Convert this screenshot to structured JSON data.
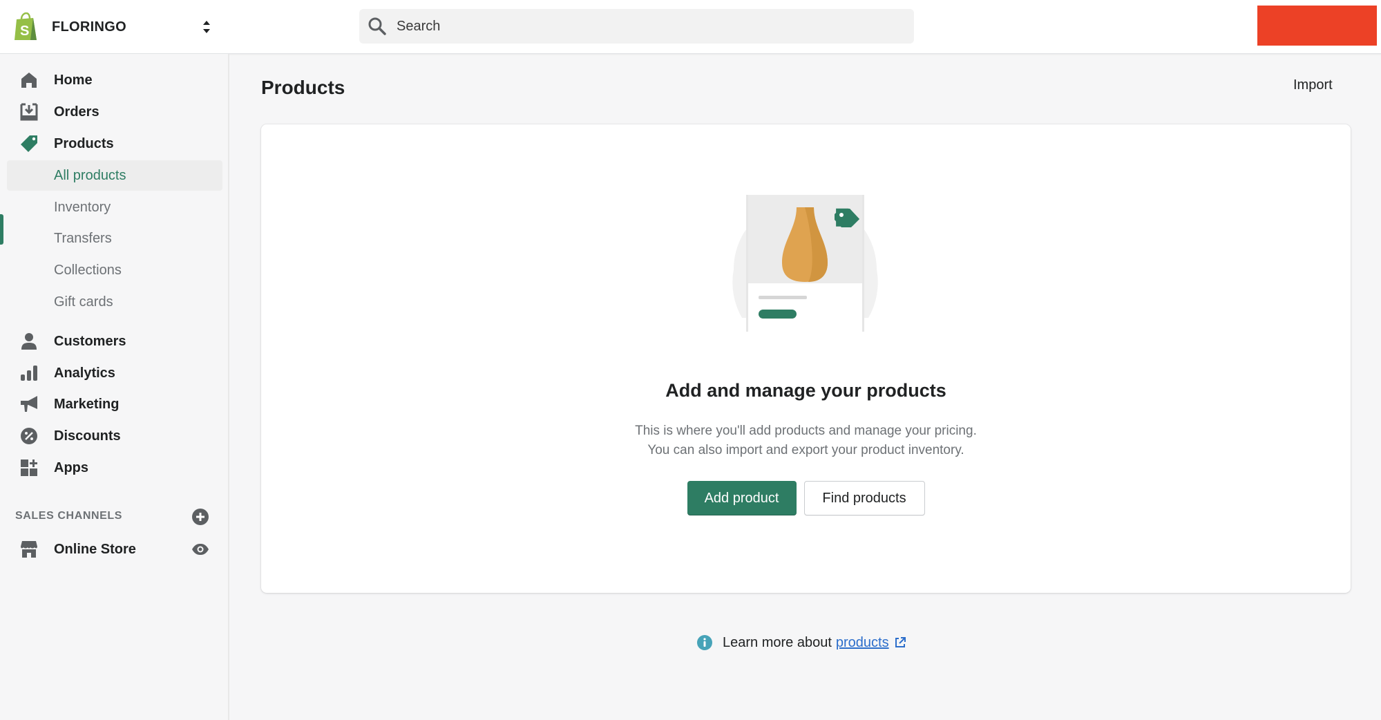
{
  "topbar": {
    "store_name": "FLORINGO",
    "search_placeholder": "Search",
    "redacted_color": "#ec4126"
  },
  "sidebar": {
    "items": [
      {
        "label": "Home",
        "icon": "home-icon"
      },
      {
        "label": "Orders",
        "icon": "orders-icon"
      },
      {
        "label": "Products",
        "icon": "tag-icon",
        "expanded": true
      },
      {
        "label": "All products",
        "sub": true,
        "active": true
      },
      {
        "label": "Inventory",
        "sub": true
      },
      {
        "label": "Transfers",
        "sub": true
      },
      {
        "label": "Collections",
        "sub": true
      },
      {
        "label": "Gift cards",
        "sub": true
      },
      {
        "label": "Customers",
        "icon": "customer-icon"
      },
      {
        "label": "Analytics",
        "icon": "analytics-icon"
      },
      {
        "label": "Marketing",
        "icon": "megaphone-icon"
      },
      {
        "label": "Discounts",
        "icon": "discount-icon"
      },
      {
        "label": "Apps",
        "icon": "apps-icon"
      }
    ],
    "sales_channels": {
      "title": "SALES CHANNELS",
      "items": [
        {
          "label": "Online Store",
          "icon": "store-icon",
          "action_icon": "eye-icon"
        }
      ]
    }
  },
  "main": {
    "title": "Products",
    "import_label": "Import",
    "empty_state": {
      "heading": "Add and manage your products",
      "body_line1": "This is where you'll add products and manage your pricing.",
      "body_line2": "You can also import and export your product inventory.",
      "primary_label": "Add product",
      "secondary_label": "Find products"
    },
    "footer_help": {
      "prefix": "Learn more about",
      "link": "products"
    }
  },
  "colors": {
    "accent": "#2e7d63",
    "link": "#2c6ecb",
    "info": "#47a3b8"
  }
}
